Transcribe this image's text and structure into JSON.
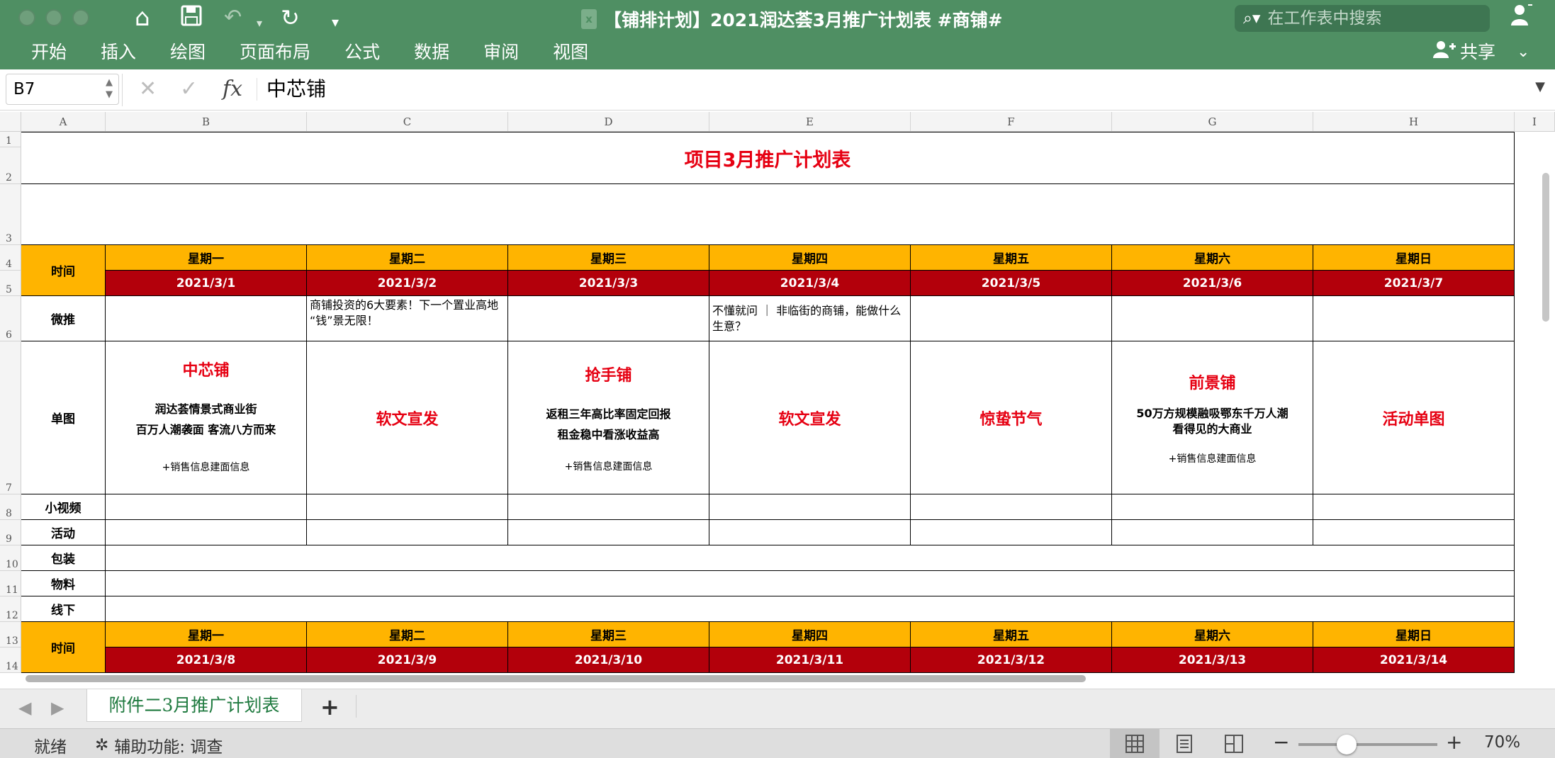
{
  "window": {
    "title": "【铺排计划】2021润达荟3月推广计划表 #商铺#",
    "file_icon": "excel-file-icon",
    "search_placeholder": "在工作表中搜索"
  },
  "ribbon": {
    "tabs": [
      "开始",
      "插入",
      "绘图",
      "页面布局",
      "公式",
      "数据",
      "审阅",
      "视图"
    ],
    "share_label": "共享"
  },
  "formula_bar": {
    "cell_ref": "B7",
    "content": "中芯铺"
  },
  "grid": {
    "columns": [
      "A",
      "B",
      "C",
      "D",
      "E",
      "F",
      "G",
      "H",
      "I"
    ],
    "rows": [
      "1",
      "2",
      "3",
      "4",
      "5",
      "6",
      "7",
      "8",
      "9",
      "10",
      "11",
      "12",
      "13",
      "14"
    ]
  },
  "plan": {
    "title": "项目3月推广计划表",
    "time_label": "时间",
    "weekdays": [
      "星期一",
      "星期二",
      "星期三",
      "星期四",
      "星期五",
      "星期六",
      "星期日"
    ],
    "dates_week1": [
      "2021/3/1",
      "2021/3/2",
      "2021/3/3",
      "2021/3/4",
      "2021/3/5",
      "2021/3/6",
      "2021/3/7"
    ],
    "dates_week2": [
      "2021/3/8",
      "2021/3/9",
      "2021/3/10",
      "2021/3/11",
      "2021/3/12",
      "2021/3/13",
      "2021/3/14"
    ],
    "row_labels": {
      "weitui": "微推",
      "dantu": "单图",
      "video": "小视频",
      "activity": "活动",
      "packaging": "包装",
      "materials": "物料",
      "offline": "线下"
    },
    "weitui": {
      "tue": "商铺投资的6大要素！下一个置业高地\n“钱”景无限！",
      "thu": "不懂就问 ｜ 非临街的商铺，能做什么生意？"
    },
    "dantu": {
      "mon": {
        "title": "中芯铺",
        "line1": "润达荟情景式商业街",
        "line2": "百万人潮袭面 客流八方而来",
        "note": "+销售信息建面信息"
      },
      "tue": "软文宣发",
      "wed": {
        "title": "抢手铺",
        "line1": "返租三年高比率固定回报",
        "line2": "租金稳中看涨收益高",
        "note": "+销售信息建面信息"
      },
      "thu": "软文宣发",
      "fri": "惊蛰节气",
      "sat": {
        "title": "前景铺",
        "line1": "50万方规模融吸鄂东千万人潮",
        "line2": "看得见的大商业",
        "note": "+销售信息建面信息"
      },
      "sun": "活动单图"
    }
  },
  "sheet_tabs": {
    "active": "附件二3月推广计划表"
  },
  "status": {
    "ready": "就绪",
    "accessibility": "辅助功能: 调查",
    "zoom": "70%",
    "zoom_level": 0.7
  },
  "colors": {
    "ribbon": "#4f8f63",
    "header_yellow": "#ffb400",
    "date_red": "#b3000b",
    "accent_red": "#e60012"
  }
}
